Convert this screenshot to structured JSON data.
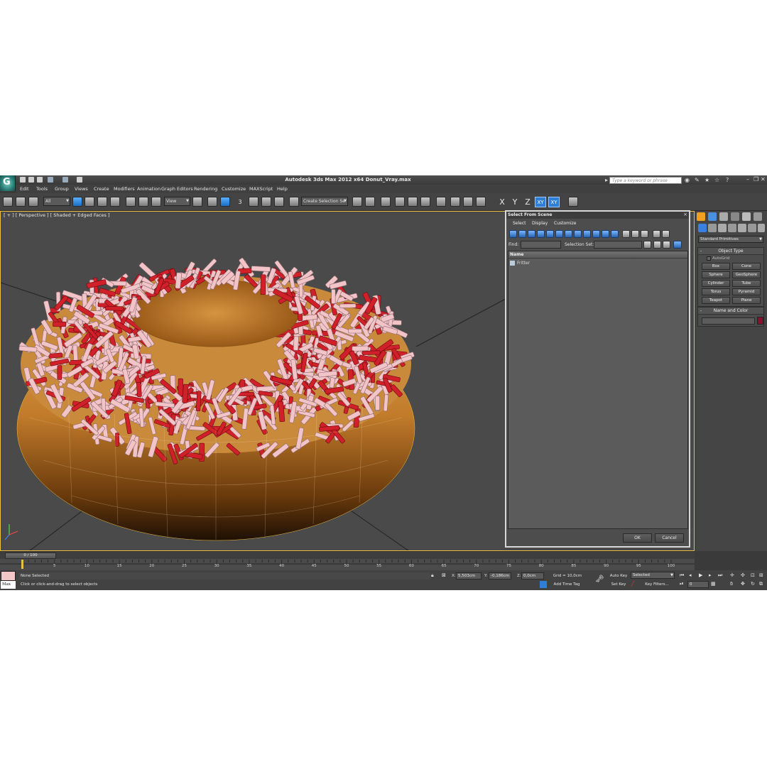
{
  "title_bar": {
    "app_title": "Autodesk 3ds Max  2012 x64    Donut_Vray.max",
    "search_placeholder": "Type a keyword or phrase",
    "help_label": "?"
  },
  "menu": [
    "Edit",
    "Tools",
    "Group",
    "Views",
    "Create",
    "Modifiers",
    "Animation",
    "Graph Editors",
    "Rendering",
    "Customize",
    "MAXScript",
    "Help"
  ],
  "toolbar": {
    "filter_value": "All",
    "refcoord_value": "View",
    "selection_set_value": "Create Selection Se",
    "snap_value": "3",
    "axes": [
      "X",
      "Y",
      "Z",
      "XY",
      "XY"
    ]
  },
  "viewport": {
    "label": "[ + ] [ Perspective ] [ Shaded + Edged Faces ]"
  },
  "select_dialog": {
    "title": "Select From Scene",
    "close": "×",
    "menu": [
      "Select",
      "Display",
      "Customize"
    ],
    "find_label": "Find:",
    "selection_set_label": "Selection Set:",
    "column_header": "Name",
    "rows": [
      "Fritter"
    ],
    "ok": "OK",
    "cancel": "Cancel"
  },
  "command_panel": {
    "category": "Standard Primitives",
    "object_type_title": "Object Type",
    "autogrid": "AutoGrid",
    "primitives": [
      "Box",
      "Cone",
      "Sphere",
      "GeoSphere",
      "Cylinder",
      "Tube",
      "Torus",
      "Pyramid",
      "Teapot",
      "Plane"
    ],
    "name_color_title": "Name and Color",
    "object_color": "#8a1030"
  },
  "timeline": {
    "frame_indicator": "0 / 100",
    "ticks": [
      "5",
      "10",
      "15",
      "20",
      "25",
      "30",
      "35",
      "40",
      "45",
      "50",
      "55",
      "60",
      "65",
      "70",
      "75",
      "80",
      "85",
      "90",
      "95",
      "100"
    ]
  },
  "status": {
    "maxscript_label": "Max",
    "selection": "None Selected",
    "prompt": "Click or click-and-drag to select objects",
    "x_label": "X:",
    "x_value": "5,503cm",
    "y_label": "Y:",
    "y_value": "-0,186cm",
    "z_label": "Z:",
    "z_value": "0,0cm",
    "grid": "Grid = 10,0cm",
    "add_time_tag": "Add Time Tag",
    "auto_key": "Auto Key",
    "set_key": "Set Key",
    "selected_dd": "Selected",
    "key_filters": "Key Filters...",
    "frame_value": "0"
  },
  "colors": {
    "accent": "#2f7fd6",
    "viewport_border": "#f0c040",
    "sprinkle_red": "#d0202a",
    "sprinkle_pink": "#f2c4c8",
    "dough": "#c07a2a"
  }
}
